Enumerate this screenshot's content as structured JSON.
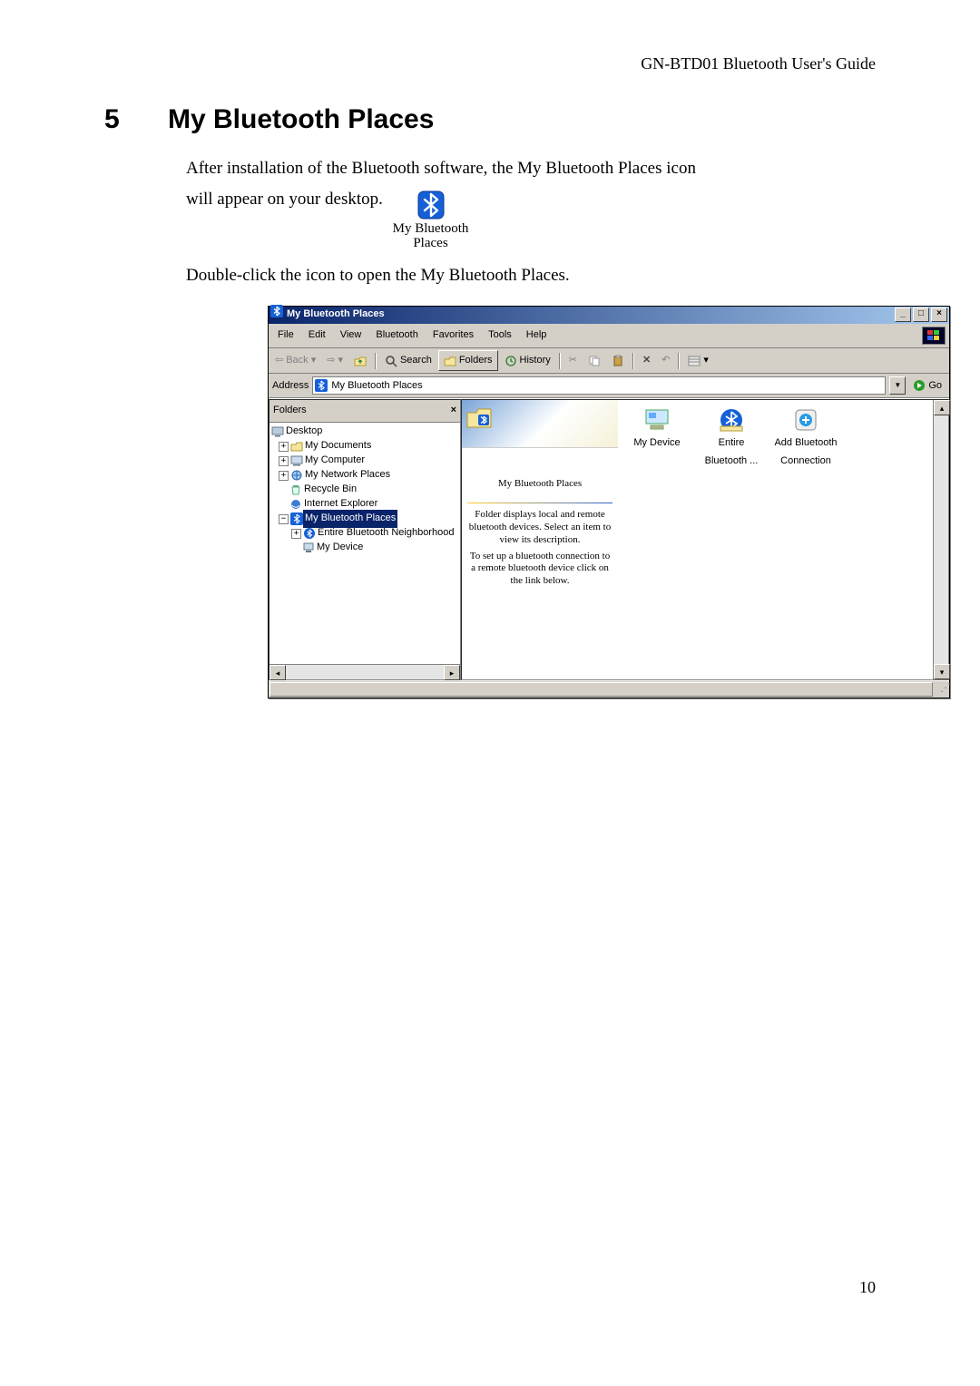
{
  "doc": {
    "running_header": "GN-BTD01 Bluetooth User's Guide",
    "chapter_num": "5",
    "chapter_title": "My Bluetooth Places",
    "para1a": "After installation of the Bluetooth software, the My Bluetooth Places icon",
    "para1b": "will appear on your desktop.",
    "desktop_icon_label_l1": "My Bluetooth",
    "desktop_icon_label_l2": "Places",
    "para2": "Double-click the icon to open the My Bluetooth Places.",
    "page_number": "10"
  },
  "win": {
    "title": "My Bluetooth Places",
    "menu": [
      "File",
      "Edit",
      "View",
      "Bluetooth",
      "Favorites",
      "Tools",
      "Help"
    ],
    "toolbar": {
      "back": "Back",
      "search": "Search",
      "folders": "Folders",
      "history": "History"
    },
    "address": {
      "label": "Address",
      "value": "My Bluetooth Places",
      "go": "Go"
    },
    "folders_pane": {
      "header": "Folders",
      "tree": {
        "n0": "Desktop",
        "n1": "My Documents",
        "n2": "My Computer",
        "n3": "My Network Places",
        "n4": "Recycle Bin",
        "n5": "Internet Explorer",
        "n6": "My Bluetooth Places",
        "n7": "Entire Bluetooth Neighborhood",
        "n8": "My Device"
      }
    },
    "info": {
      "title": "My Bluetooth Places",
      "p1": "Folder displays local and remote bluetooth devices. Select an item to view its description.",
      "p2": "To set up a bluetooth connection to a remote bluetooth device click on the link below."
    },
    "items": {
      "i0_l1": "My Device",
      "i1_l1": "Entire",
      "i1_l2": "Bluetooth ...",
      "i2_l1": "Add Bluetooth",
      "i2_l2": "Connection"
    }
  }
}
